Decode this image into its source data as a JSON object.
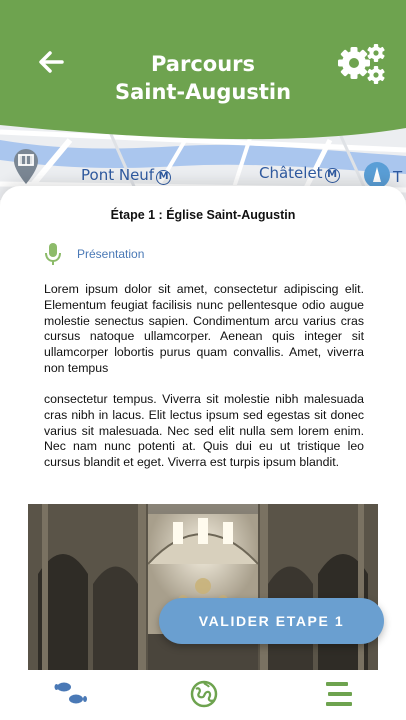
{
  "header": {
    "title_line1": "Parcours",
    "title_line2": "Saint-Augustin",
    "back_icon": "arrow-left-icon",
    "settings_icon": "gears-icon",
    "color": "#6ea34f"
  },
  "map": {
    "labels": [
      "Pont Neuf",
      "Châtelet",
      "T"
    ],
    "metro_badge": "M"
  },
  "stage": {
    "title": "Étape 1 : Église Saint-Augustin",
    "audio_label": "Présentation",
    "audio_icon": "microphone-icon",
    "paragraphs": [
      "Lorem ipsum dolor sit amet, consectetur adipiscing elit. Elementum feugiat facilisis nunc pellentesque odio augue molestie senectus sapien. Condimentum arcu varius cras cursus natoque ullamcorper. Aenean quis integer sit ullamcorper lobortis purus quam convallis. Amet, viverra non tempus",
      "consectetur tempus. Viverra sit molestie nibh malesuada cras nibh in lacus. Elit lectus ipsum sed egestas sit donec varius sit malesuada. Nec sed elit nulla sem lorem enim. Nec nam nunc potenti at. Quis dui eu ut tristique leo cursus blandit et eget. Viverra est turpis ipsum blandit."
    ]
  },
  "validate_button": {
    "label": "VALIDER ETAPE 1",
    "color": "#6a9fd0"
  },
  "bottom_nav": {
    "items": [
      "footsteps-icon",
      "globe-icon",
      "menu-icon"
    ],
    "colors": [
      "#4a79b6",
      "#6ea34f",
      "#6ea34f"
    ]
  }
}
